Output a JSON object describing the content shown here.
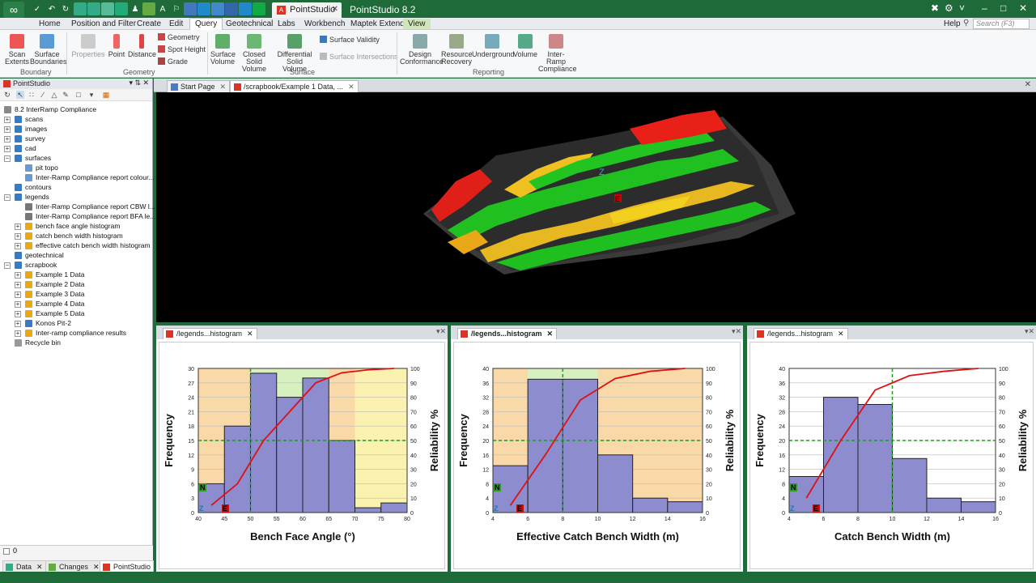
{
  "titlebar": {
    "doc_tab": "PointStudio",
    "app_title": "PointStudio 8.2",
    "win_controls": [
      "–",
      "□",
      "✕"
    ]
  },
  "menubar": {
    "items": [
      "Home",
      "Position and Filter",
      "Create",
      "Edit",
      "Query",
      "Geotechnical",
      "Labs",
      "Workbench",
      "Maptek Extend",
      "View"
    ],
    "active": "Query",
    "help": "Help",
    "search_placeholder": "Search (F3)"
  },
  "ribbon": {
    "buttons": [
      "Scan Extents",
      "Surface Boundaries",
      "Properties",
      "Point",
      "Distance",
      "Surface Volume",
      "Closed Solid Volume",
      "Differential Solid Volume",
      "Design Conformance",
      "Resource Recovery",
      "Underground",
      "Volume",
      "Inter-Ramp Compliance"
    ],
    "small": [
      "Geometry",
      "Spot Height",
      "Grade",
      "Surface Validity",
      "Surface Intersections"
    ],
    "groups": [
      "Boundary",
      "Geometry",
      "Surface",
      "Reporting"
    ]
  },
  "left_panel": {
    "title": "PointStudio",
    "tree": [
      {
        "label": "8.2 InterRamp Compliance",
        "level": 0,
        "icon": "project-icon",
        "pm": ""
      },
      {
        "label": "scans",
        "level": 1,
        "icon": "container-icon",
        "pm": "+"
      },
      {
        "label": "images",
        "level": 1,
        "icon": "container-icon",
        "pm": "+"
      },
      {
        "label": "survey",
        "level": 1,
        "icon": "container-icon",
        "pm": "+"
      },
      {
        "label": "cad",
        "level": 1,
        "icon": "container-icon",
        "pm": "+"
      },
      {
        "label": "surfaces",
        "level": 1,
        "icon": "container-icon",
        "pm": "−"
      },
      {
        "label": "pit topo",
        "level": 2,
        "icon": "surface-icon",
        "pm": ""
      },
      {
        "label": "Inter-Ramp Compliance report colour...",
        "level": 2,
        "icon": "surface-icon",
        "pm": ""
      },
      {
        "label": "contours",
        "level": 1,
        "icon": "container-icon",
        "pm": ""
      },
      {
        "label": "legends",
        "level": 1,
        "icon": "container-icon",
        "pm": "−"
      },
      {
        "label": "Inter-Ramp Compliance report CBW l...",
        "level": 2,
        "icon": "legend-icon",
        "pm": ""
      },
      {
        "label": "Inter-Ramp Compliance report BFA le...",
        "level": 2,
        "icon": "legend-icon",
        "pm": ""
      },
      {
        "label": "bench face angle histogram",
        "level": 2,
        "icon": "chart-icon",
        "pm": "+"
      },
      {
        "label": "catch bench width histogram",
        "level": 2,
        "icon": "chart-icon",
        "pm": "+"
      },
      {
        "label": "effective catch bench width histogram",
        "level": 2,
        "icon": "chart-icon",
        "pm": "+"
      },
      {
        "label": "geotechnical",
        "level": 1,
        "icon": "container-icon",
        "pm": ""
      },
      {
        "label": "scrapbook",
        "level": 1,
        "icon": "container-icon",
        "pm": "−"
      },
      {
        "label": "Example 1 Data",
        "level": 2,
        "icon": "chart-icon",
        "pm": "+"
      },
      {
        "label": "Example 2 Data",
        "level": 2,
        "icon": "chart-icon",
        "pm": "+"
      },
      {
        "label": "Example 3 Data",
        "level": 2,
        "icon": "chart-icon",
        "pm": "+"
      },
      {
        "label": "Example 4 Data",
        "level": 2,
        "icon": "chart-icon",
        "pm": "+"
      },
      {
        "label": "Example 5 Data",
        "level": 2,
        "icon": "chart-icon",
        "pm": "+"
      },
      {
        "label": "Konos Pit-2",
        "level": 2,
        "icon": "container-icon",
        "pm": "+"
      },
      {
        "label": "Inter-ramp compliance results",
        "level": 2,
        "icon": "chart-icon",
        "pm": "+"
      },
      {
        "label": "Recycle bin",
        "level": 1,
        "icon": "recycle-icon",
        "pm": ""
      }
    ],
    "footer_input": "0",
    "bottom_tabs": [
      "Data",
      "Changes",
      "PointStudio"
    ],
    "active_bottom_tab": "PointStudio"
  },
  "doc_tabs": [
    "Start Page",
    "/scrapbook/Example 1 Data, ..."
  ],
  "view3d": {
    "markers": [
      "Z",
      "E"
    ]
  },
  "panels": [
    {
      "tab": "/legends...histogram",
      "bold": false
    },
    {
      "tab": "/legends...histogram",
      "bold": true
    },
    {
      "tab": "/legends...histogram",
      "bold": false
    }
  ],
  "chart_data": [
    {
      "type": "bar",
      "title": "",
      "xlabel": "Bench Face Angle (°)",
      "ylabel": "Frequency",
      "y2label": "Reliability %",
      "xlim": [
        40,
        80
      ],
      "ylim": [
        0,
        30
      ],
      "y2lim": [
        0,
        100
      ],
      "xticks": [
        40,
        45,
        50,
        55,
        60,
        65,
        70,
        75,
        80
      ],
      "yticks": [
        0,
        3,
        6,
        9,
        12,
        15,
        18,
        21,
        24,
        27,
        30
      ],
      "y2ticks": [
        0,
        10,
        20,
        30,
        40,
        50,
        60,
        70,
        80,
        90,
        100
      ],
      "bins": [
        [
          40,
          45
        ],
        [
          45,
          50
        ],
        [
          50,
          55
        ],
        [
          55,
          60
        ],
        [
          60,
          65
        ],
        [
          65,
          70
        ],
        [
          70,
          75
        ],
        [
          75,
          80
        ]
      ],
      "values": [
        6,
        18,
        29,
        24,
        28,
        15,
        1,
        2
      ],
      "cumulative": {
        "x": [
          42.5,
          47.5,
          52.5,
          57.5,
          62.5,
          67.5,
          72.5,
          77.5
        ],
        "y": [
          5,
          20,
          50,
          70,
          90,
          97,
          99,
          100
        ]
      },
      "zones": [
        {
          "from": 40,
          "to": 50,
          "color": "#f9d9a8"
        },
        {
          "from": 50,
          "to": 65,
          "color": "#d6f0c0"
        },
        {
          "from": 65,
          "to": 70,
          "color": "#f9d9a8"
        },
        {
          "from": 70,
          "to": 80,
          "color": "#fbf2b0"
        }
      ],
      "vline": 50,
      "hline": 50,
      "marker_letters": [
        "N",
        "Z",
        "E"
      ]
    },
    {
      "type": "bar",
      "title": "",
      "xlabel": "Effective Catch Bench Width (m)",
      "ylabel": "Frequency",
      "y2label": "Reliability %",
      "xlim": [
        4,
        16
      ],
      "ylim": [
        0,
        40
      ],
      "y2lim": [
        0,
        100
      ],
      "xticks": [
        4,
        6,
        8,
        10,
        12,
        14,
        16
      ],
      "yticks": [
        0,
        4,
        8,
        12,
        16,
        20,
        24,
        28,
        32,
        36,
        40
      ],
      "y2ticks": [
        0,
        10,
        20,
        30,
        40,
        50,
        60,
        70,
        80,
        90,
        100
      ],
      "bins": [
        [
          4,
          6
        ],
        [
          6,
          8
        ],
        [
          8,
          10
        ],
        [
          10,
          12
        ],
        [
          12,
          14
        ],
        [
          14,
          16
        ]
      ],
      "values": [
        13,
        37,
        37,
        16,
        4,
        3
      ],
      "cumulative": {
        "x": [
          5,
          7,
          9,
          11,
          13,
          15
        ],
        "y": [
          5,
          40,
          78,
          93,
          98,
          100
        ]
      },
      "zones": [
        {
          "from": 4,
          "to": 6,
          "color": "#f9d9a8"
        },
        {
          "from": 6,
          "to": 10,
          "color": "#d6f0c0"
        },
        {
          "from": 10,
          "to": 16,
          "color": "#f9d9a8"
        }
      ],
      "vline": 8,
      "hline": 50,
      "marker_letters": [
        "N",
        "Z",
        "E"
      ]
    },
    {
      "type": "bar",
      "title": "",
      "xlabel": "Catch Bench Width (m)",
      "ylabel": "Frequency",
      "y2label": "Reliability %",
      "xlim": [
        4,
        16
      ],
      "ylim": [
        0,
        40
      ],
      "y2lim": [
        0,
        100
      ],
      "xticks": [
        4,
        6,
        8,
        10,
        12,
        14,
        16
      ],
      "yticks": [
        0,
        4,
        8,
        12,
        16,
        20,
        24,
        28,
        32,
        36,
        40
      ],
      "y2ticks": [
        0,
        10,
        20,
        30,
        40,
        50,
        60,
        70,
        80,
        90,
        100
      ],
      "bins": [
        [
          4,
          6
        ],
        [
          6,
          8
        ],
        [
          8,
          10
        ],
        [
          10,
          12
        ],
        [
          12,
          14
        ],
        [
          14,
          16
        ]
      ],
      "values": [
        10,
        32,
        30,
        15,
        4,
        3
      ],
      "cumulative": {
        "x": [
          5,
          7,
          9,
          11,
          13,
          15
        ],
        "y": [
          10,
          50,
          85,
          95,
          98,
          100
        ]
      },
      "zones": [],
      "vline": 10,
      "hline": 50,
      "marker_letters": [
        "N",
        "Z",
        "E"
      ]
    }
  ]
}
